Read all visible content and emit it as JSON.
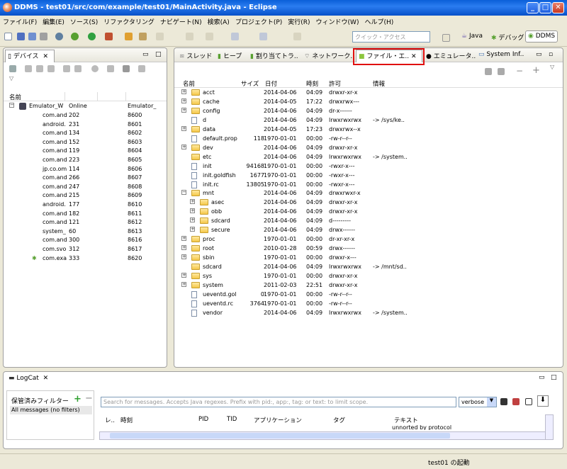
{
  "window": {
    "title": "DDMS - test01/src/com/example/test01/MainActivity.java - Eclipse",
    "minimize": "_",
    "maximize": "□",
    "close": "✕"
  },
  "menu": [
    "ファイル(F)",
    "編集(E)",
    "ソース(S)",
    "リファクタリング",
    "ナビゲート(N)",
    "検索(A)",
    "プロジェクト(P)",
    "実行(R)",
    "ウィンドウ(W)",
    "ヘルプ(H)"
  ],
  "toolbar": {
    "quick_access_placeholder": "クイック・アクセス",
    "perspectives": [
      "Java",
      "デバッグ",
      "DDMS"
    ]
  },
  "devices_panel": {
    "tab_label": "デバイス",
    "col_name": "名前",
    "device": {
      "name": "Emulator_W",
      "status": "Online",
      "serial": "Emulator_"
    },
    "processes": [
      {
        "name": "com.and",
        "pid": "202",
        "port": "8600"
      },
      {
        "name": "android.",
        "pid": "231",
        "port": "8601"
      },
      {
        "name": "com.and",
        "pid": "134",
        "port": "8602"
      },
      {
        "name": "com.and",
        "pid": "152",
        "port": "8603"
      },
      {
        "name": "com.and",
        "pid": "119",
        "port": "8604"
      },
      {
        "name": "com.and",
        "pid": "223",
        "port": "8605"
      },
      {
        "name": "jp.co.omi",
        "pid": "114",
        "port": "8606"
      },
      {
        "name": "com.and",
        "pid": "266",
        "port": "8607"
      },
      {
        "name": "com.and",
        "pid": "247",
        "port": "8608"
      },
      {
        "name": "com.and",
        "pid": "215",
        "port": "8609"
      },
      {
        "name": "android.",
        "pid": "177",
        "port": "8610"
      },
      {
        "name": "com.and",
        "pid": "182",
        "port": "8611"
      },
      {
        "name": "com.and",
        "pid": "121",
        "port": "8612"
      },
      {
        "name": "system_",
        "pid": "60",
        "port": "8613"
      },
      {
        "name": "com.and",
        "pid": "300",
        "port": "8616"
      },
      {
        "name": "com.svo",
        "pid": "312",
        "port": "8617"
      },
      {
        "name": "com.exa",
        "pid": "333",
        "port": "8620"
      }
    ]
  },
  "main_tabs": [
    "スレッド",
    "ヒープ",
    "割り当てトラ..",
    "ネットワーク..",
    "ファイル・エ..",
    "エミュレータ..",
    "System Inf.."
  ],
  "file_explorer": {
    "columns": [
      "名前",
      "サイズ",
      "日付",
      "時刻",
      "許可",
      "情報"
    ],
    "rows": [
      {
        "name": "acct",
        "size": "",
        "date": "2014-04-06",
        "time": "04:09",
        "perm": "drwxr-xr-x",
        "info": "",
        "type": "folder",
        "indent": 0,
        "exp": "+"
      },
      {
        "name": "cache",
        "size": "",
        "date": "2014-04-05",
        "time": "17:22",
        "perm": "drwxrwx---",
        "info": "",
        "type": "folder",
        "indent": 0,
        "exp": "+"
      },
      {
        "name": "config",
        "size": "",
        "date": "2014-04-06",
        "time": "04:09",
        "perm": "dr-x------",
        "info": "",
        "type": "folder",
        "indent": 0,
        "exp": "+"
      },
      {
        "name": "d",
        "size": "",
        "date": "2014-04-06",
        "time": "04:09",
        "perm": "lrwxrwxrwx",
        "info": "-> /sys/ke..",
        "type": "file",
        "indent": 0,
        "exp": ""
      },
      {
        "name": "data",
        "size": "",
        "date": "2014-04-05",
        "time": "17:23",
        "perm": "drwxrwx--x",
        "info": "",
        "type": "folder",
        "indent": 0,
        "exp": "+"
      },
      {
        "name": "default.prop",
        "size": "118",
        "date": "1970-01-01",
        "time": "00:00",
        "perm": "-rw-r--r--",
        "info": "",
        "type": "file",
        "indent": 0,
        "exp": ""
      },
      {
        "name": "dev",
        "size": "",
        "date": "2014-04-06",
        "time": "04:09",
        "perm": "drwxr-xr-x",
        "info": "",
        "type": "folder",
        "indent": 0,
        "exp": "+"
      },
      {
        "name": "etc",
        "size": "",
        "date": "2014-04-06",
        "time": "04:09",
        "perm": "lrwxrwxrwx",
        "info": "-> /system..",
        "type": "folder",
        "indent": 0,
        "exp": ""
      },
      {
        "name": "init",
        "size": "94168",
        "date": "1970-01-01",
        "time": "00:00",
        "perm": "-rwxr-x---",
        "info": "",
        "type": "file",
        "indent": 0,
        "exp": ""
      },
      {
        "name": "init.goldfish",
        "size": "1677",
        "date": "1970-01-01",
        "time": "00:00",
        "perm": "-rwxr-x---",
        "info": "",
        "type": "file",
        "indent": 0,
        "exp": ""
      },
      {
        "name": "init.rc",
        "size": "13805",
        "date": "1970-01-01",
        "time": "00:00",
        "perm": "-rwxr-x---",
        "info": "",
        "type": "file",
        "indent": 0,
        "exp": ""
      },
      {
        "name": "mnt",
        "size": "",
        "date": "2014-04-06",
        "time": "04:09",
        "perm": "drwxrwxr-x",
        "info": "",
        "type": "folder",
        "indent": 0,
        "exp": "−"
      },
      {
        "name": "asec",
        "size": "",
        "date": "2014-04-06",
        "time": "04:09",
        "perm": "drwxr-xr-x",
        "info": "",
        "type": "folder",
        "indent": 1,
        "exp": "+"
      },
      {
        "name": "obb",
        "size": "",
        "date": "2014-04-06",
        "time": "04:09",
        "perm": "drwxr-xr-x",
        "info": "",
        "type": "folder",
        "indent": 1,
        "exp": "+"
      },
      {
        "name": "sdcard",
        "size": "",
        "date": "2014-04-06",
        "time": "04:09",
        "perm": "d---------",
        "info": "",
        "type": "folder",
        "indent": 1,
        "exp": "+"
      },
      {
        "name": "secure",
        "size": "",
        "date": "2014-04-06",
        "time": "04:09",
        "perm": "drwx------",
        "info": "",
        "type": "folder",
        "indent": 1,
        "exp": "+"
      },
      {
        "name": "proc",
        "size": "",
        "date": "1970-01-01",
        "time": "00:00",
        "perm": "dr-xr-xr-x",
        "info": "",
        "type": "folder",
        "indent": 0,
        "exp": "+"
      },
      {
        "name": "root",
        "size": "",
        "date": "2010-01-28",
        "time": "00:59",
        "perm": "drwx------",
        "info": "",
        "type": "folder",
        "indent": 0,
        "exp": "+"
      },
      {
        "name": "sbin",
        "size": "",
        "date": "1970-01-01",
        "time": "00:00",
        "perm": "drwxr-x---",
        "info": "",
        "type": "folder",
        "indent": 0,
        "exp": "+"
      },
      {
        "name": "sdcard",
        "size": "",
        "date": "2014-04-06",
        "time": "04:09",
        "perm": "lrwxrwxrwx",
        "info": "-> /mnt/sd..",
        "type": "folder",
        "indent": 0,
        "exp": ""
      },
      {
        "name": "sys",
        "size": "",
        "date": "1970-01-01",
        "time": "00:00",
        "perm": "drwxr-xr-x",
        "info": "",
        "type": "folder",
        "indent": 0,
        "exp": "+"
      },
      {
        "name": "system",
        "size": "",
        "date": "2011-02-03",
        "time": "22:51",
        "perm": "drwxr-xr-x",
        "info": "",
        "type": "folder",
        "indent": 0,
        "exp": "+"
      },
      {
        "name": "ueventd.gol",
        "size": "0",
        "date": "1970-01-01",
        "time": "00:00",
        "perm": "-rw-r--r--",
        "info": "",
        "type": "file",
        "indent": 0,
        "exp": ""
      },
      {
        "name": "ueventd.rc",
        "size": "3764",
        "date": "1970-01-01",
        "time": "00:00",
        "perm": "-rw-r--r--",
        "info": "",
        "type": "file",
        "indent": 0,
        "exp": ""
      },
      {
        "name": "vendor",
        "size": "",
        "date": "2014-04-06",
        "time": "04:09",
        "perm": "lrwxrwxrwx",
        "info": "-> /system..",
        "type": "file",
        "indent": 0,
        "exp": ""
      }
    ]
  },
  "logcat": {
    "tab_label": "LogCat",
    "filters_label": "保管済みフィルター",
    "all_messages": "All messages (no filters)",
    "search_placeholder": "Search for messages. Accepts Java regexes. Prefix with pid:, app:, tag: or text: to limit scope.",
    "level_select": "verbose",
    "columns": [
      "レ..",
      "時刻",
      "PID",
      "TID",
      "アプリケーション",
      "タグ",
      "テキスト"
    ],
    "partial_text": "unnorted by protocol"
  },
  "status": {
    "text": "test01 の起動"
  },
  "colors": {
    "titlebar": "#0a5fd8",
    "highlight_box": "#e01010",
    "android_green": "#8cc63f"
  }
}
